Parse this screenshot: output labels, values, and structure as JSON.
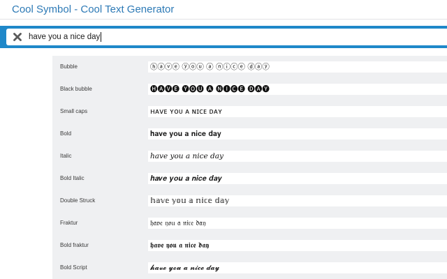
{
  "app": {
    "title": "Cool Symbol - Cool Text Generator"
  },
  "search": {
    "value": "have you a nice day",
    "clear_icon": "close-icon"
  },
  "colors": {
    "brand": "#2d7ab6",
    "search_bar": "#1f88c9",
    "row_background": "#eff0f2",
    "icon": "#5a5a5a"
  },
  "styles": [
    {
      "label": "Bubble",
      "text": "ⓗⓐⓥⓔ ⓨⓞⓤ ⓐ ⓝⓘⓒⓔ ⓓⓐⓨ"
    },
    {
      "label": "Black bubble",
      "text": "🅗🅐🅥🅔 🅨🅞🅤 🅐 🅝🅘🅒🅔 🅓🅐🅨"
    },
    {
      "label": "Small caps",
      "text": "ʜᴀᴠᴇ ʏᴏᴜ ᴀ ɴɪᴄᴇ ᴅᴀʏ"
    },
    {
      "label": "Bold",
      "text": "𝐡𝐚𝐯𝐞 𝐲𝐨𝐮 𝐚 𝐧𝐢𝐜𝐞 𝐝𝐚𝐲"
    },
    {
      "label": "Italic",
      "text": "ℎ𝑎𝑣𝑒 𝑦𝑜𝑢 𝑎 𝑛𝑖𝑐𝑒 𝑑𝑎𝑦"
    },
    {
      "label": "Bold Italic",
      "text": "𝒉𝒂𝒗𝒆 𝒚𝒐𝒖 𝒂 𝒏𝒊𝒄𝒆 𝒅𝒂𝒚"
    },
    {
      "label": "Double Struck",
      "text": "𝕙𝕒𝕧𝕖 𝕪𝕠𝕦 𝕒 𝕟𝕚𝕔𝕖 𝕕𝕒𝕪"
    },
    {
      "label": "Fraktur",
      "text": "𝔥𝔞𝔳𝔢 𝔶𝔬𝔲 𝔞 𝔫𝔦𝔠𝔢 𝔡𝔞𝔶"
    },
    {
      "label": "Bold fraktur",
      "text": "𝖍𝖆𝖛𝖊 𝖞𝖔𝖚 𝖆 𝖓𝖎𝖈𝖊 𝖉𝖆𝖞"
    },
    {
      "label": "Bold Script",
      "text": "𝓱𝓪𝓿𝓮 𝔂𝓸𝓾 𝓪 𝓷𝓲𝓬𝓮 𝓭𝓪𝔂"
    }
  ]
}
